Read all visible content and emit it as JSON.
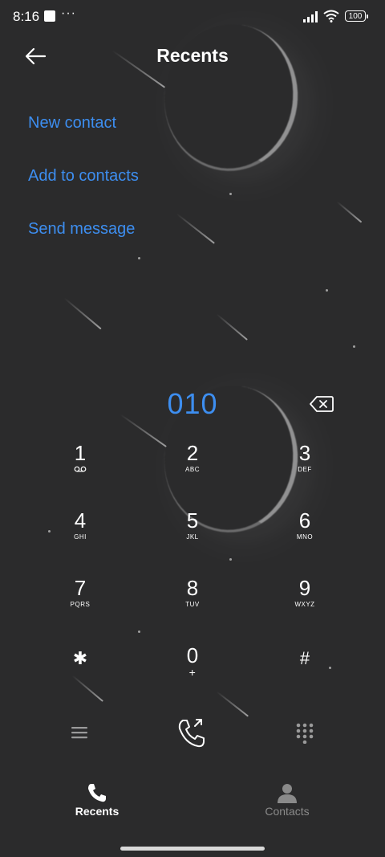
{
  "status_bar": {
    "time": "8:16",
    "more": "···",
    "battery": "100"
  },
  "header": {
    "title": "Recents"
  },
  "actions": [
    "New contact",
    "Add to contacts",
    "Send message"
  ],
  "dialed_number": "010",
  "keypad": [
    {
      "digit": "1",
      "sub": ""
    },
    {
      "digit": "2",
      "sub": "ABC"
    },
    {
      "digit": "3",
      "sub": "DEF"
    },
    {
      "digit": "4",
      "sub": "GHI"
    },
    {
      "digit": "5",
      "sub": "JKL"
    },
    {
      "digit": "6",
      "sub": "MNO"
    },
    {
      "digit": "7",
      "sub": "PQRS"
    },
    {
      "digit": "8",
      "sub": "TUV"
    },
    {
      "digit": "9",
      "sub": "WXYZ"
    },
    {
      "digit": "✱",
      "sub": ""
    },
    {
      "digit": "0",
      "sub": "+"
    },
    {
      "digit": "#",
      "sub": ""
    }
  ],
  "tabs": {
    "recents": "Recents",
    "contacts": "Contacts"
  },
  "colors": {
    "accent": "#3d8ef0",
    "background": "#2b2b2c",
    "inactive": "#8a8a8a"
  }
}
